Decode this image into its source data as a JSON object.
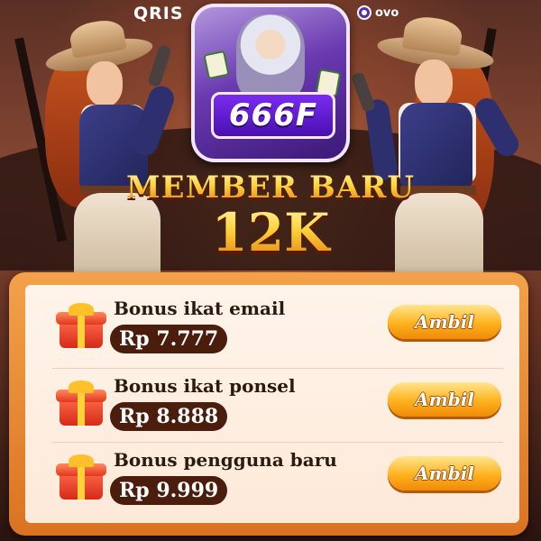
{
  "header": {
    "payment_left": "QRIS",
    "payment_right": "ovo",
    "logo_text": "666F",
    "logo_icon": "zeus-logo-icon"
  },
  "promo": {
    "line1": "MEMBER BARU",
    "line2": "12K"
  },
  "bonuses": [
    {
      "title": "Bonus ikat email",
      "amount": "Rp 7.777",
      "button": "Ambil",
      "icon": "gift-icon"
    },
    {
      "title": "Bonus ikat ponsel",
      "amount": "Rp 8.888",
      "button": "Ambil",
      "icon": "gift-icon"
    },
    {
      "title": "Bonus pengguna baru",
      "amount": "Rp 9.999",
      "button": "Ambil",
      "icon": "gift-icon"
    }
  ],
  "colors": {
    "panel_orange": "#e98a34",
    "button_gold": "#ffb11d",
    "amount_pill": "#4a1d0c",
    "logo_purple": "#6a3ab0"
  }
}
